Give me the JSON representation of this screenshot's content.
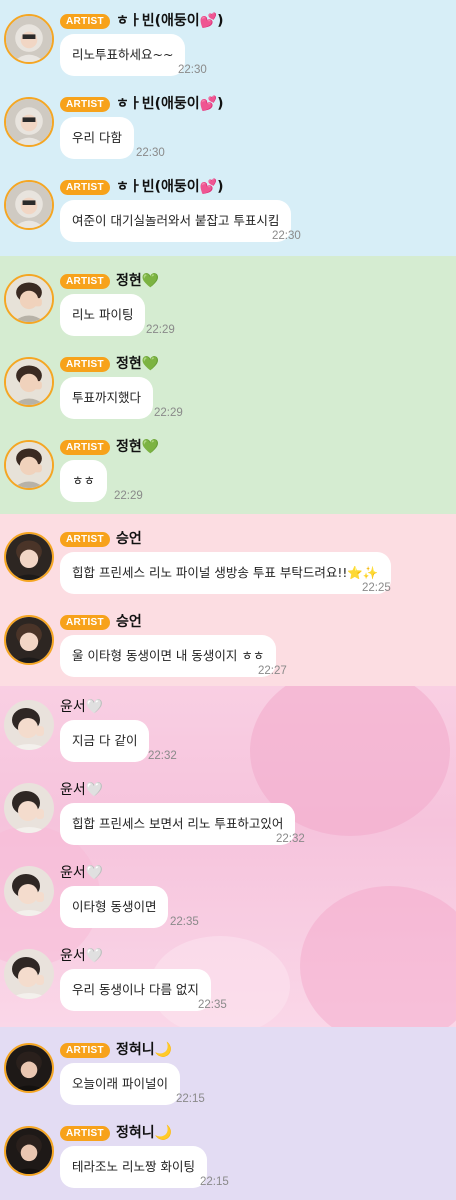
{
  "sections": [
    {
      "messages": [
        {
          "badge": "ARTIST",
          "name": "ㅎㅏ빈(애둥이💕)",
          "text": "리노투표하세요~~",
          "time": "22:30"
        },
        {
          "badge": "ARTIST",
          "name": "ㅎㅏ빈(애둥이💕)",
          "text": "우리 다함",
          "time": "22:30"
        },
        {
          "badge": "ARTIST",
          "name": "ㅎㅏ빈(애둥이💕)",
          "text": "여준이 대기실놀러와서 붙잡고 투표시킴",
          "time": "22:30"
        }
      ]
    },
    {
      "messages": [
        {
          "badge": "ARTIST",
          "name": "정현💚",
          "text": "리노 파이팅",
          "time": "22:29"
        },
        {
          "badge": "ARTIST",
          "name": "정현💚",
          "text": "투표까지했다",
          "time": "22:29"
        },
        {
          "badge": "ARTIST",
          "name": "정현💚",
          "text": "ㅎㅎ",
          "time": "22:29"
        }
      ]
    },
    {
      "messages": [
        {
          "badge": "ARTIST",
          "name": "승언",
          "text": "힙합 프린세스 리노 파이널 생방송 투표 부탁드려요!!⭐✨",
          "time": "22:25"
        },
        {
          "badge": "ARTIST",
          "name": "승언",
          "text": "울 이타형 동생이면 내 동생이지 ㅎㅎ",
          "time": "22:27"
        }
      ]
    },
    {
      "messages": [
        {
          "badge": "",
          "name": "윤서🤍",
          "text": "지금 다 같이",
          "time": "22:32"
        },
        {
          "badge": "",
          "name": "윤서🤍",
          "text": "힙합 프린세스 보면서 리노 투표하고있어",
          "time": "22:32"
        },
        {
          "badge": "",
          "name": "윤서🤍",
          "text": "이타형 동생이면",
          "time": "22:35"
        },
        {
          "badge": "",
          "name": "윤서🤍",
          "text": "우리 동생이나 다름 없지",
          "time": "22:35"
        }
      ]
    },
    {
      "messages": [
        {
          "badge": "ARTIST",
          "name": "정혀니🌙",
          "text": "오늘이래 파이널이",
          "time": "22:15"
        },
        {
          "badge": "ARTIST",
          "name": "정혀니🌙",
          "text": "테라조노 리노짱 화이팅",
          "time": "22:15"
        }
      ]
    }
  ],
  "colors": {
    "badge": "#f7a21b",
    "section_1": "#d7eef7",
    "section_2": "#d5ecd1",
    "section_3": "#fcdde2",
    "section_4": "#f8c8df",
    "section_5": "#e3dcf3"
  }
}
